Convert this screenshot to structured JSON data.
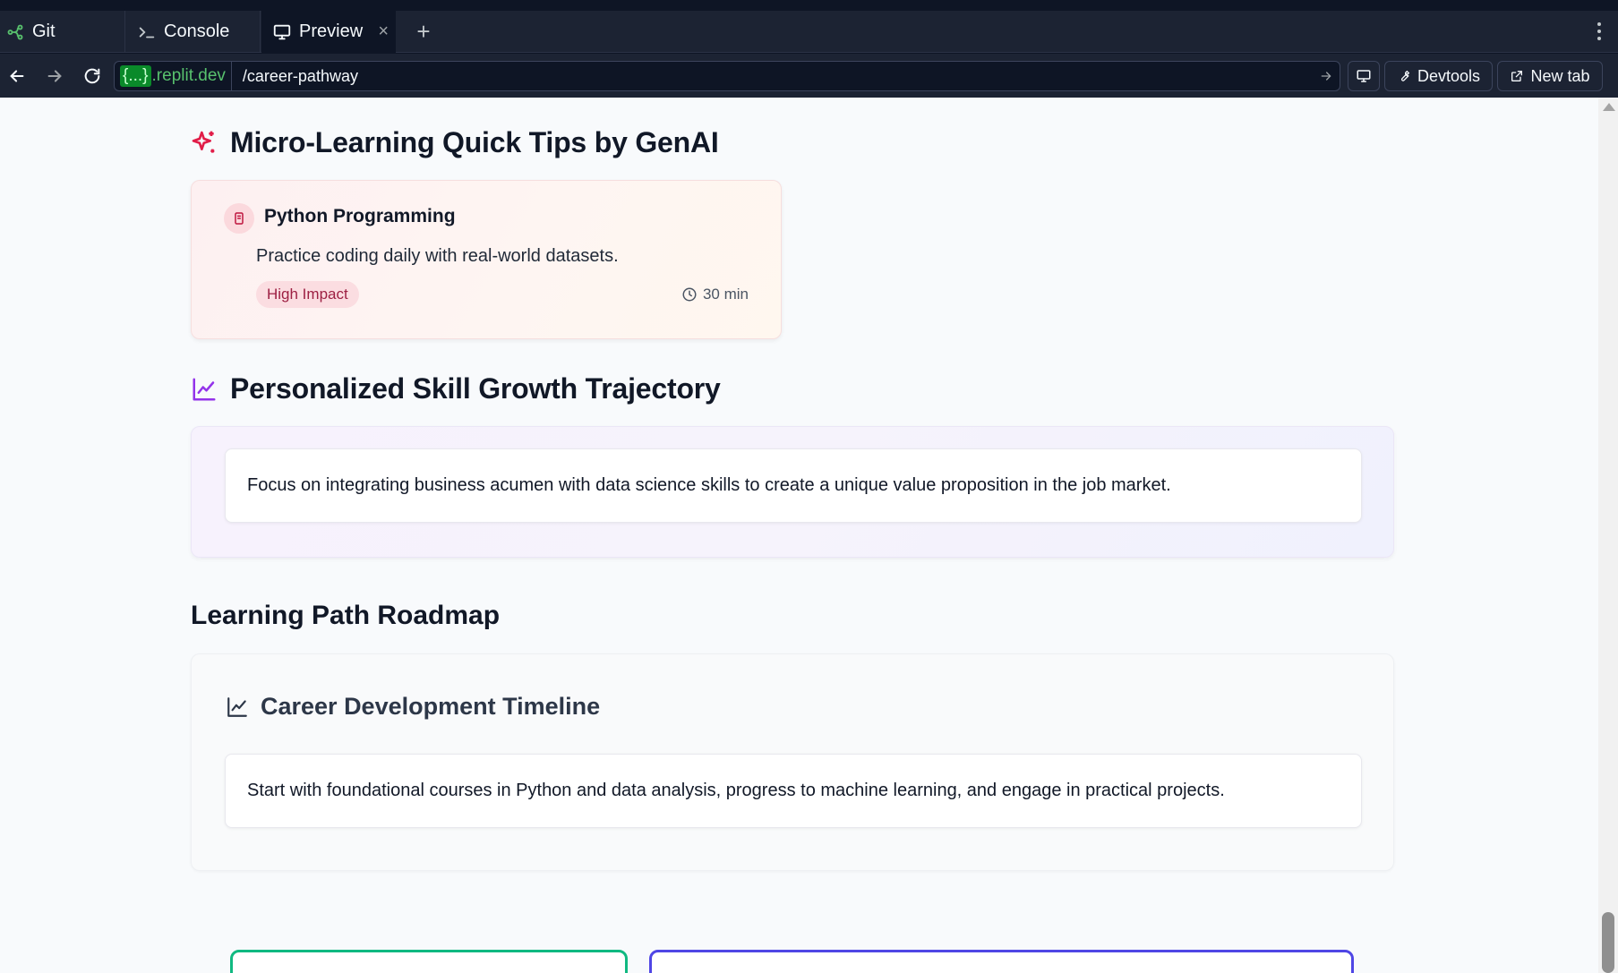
{
  "tabs": {
    "git_label": "Git",
    "console_label": "Console",
    "preview_label": "Preview"
  },
  "address": {
    "domain_brace": "{...}",
    "domain_suffix": ".replit.dev",
    "path": "/career-pathway"
  },
  "toolbar": {
    "devtools_label": "Devtools",
    "newtab_label": "New tab"
  },
  "micro_learning": {
    "heading": "Micro-Learning Quick Tips by GenAI",
    "tip": {
      "title": "Python Programming",
      "text": "Practice coding daily with real-world datasets.",
      "badge": "High Impact",
      "duration": "30 min"
    }
  },
  "skill_growth": {
    "heading": "Personalized Skill Growth Trajectory",
    "text": "Focus on integrating business acumen with data science skills to create a unique value proposition in the job market."
  },
  "roadmap": {
    "heading": "Learning Path Roadmap",
    "timeline_title": "Career Development Timeline",
    "text": "Start with foundational courses in Python and data analysis, progress to machine learning, and engage in practical projects."
  },
  "colors": {
    "accent_pink": "#e11d48",
    "accent_purple": "#9333ea",
    "card_green_border": "#10b981",
    "card_blue_border": "#4f46e5",
    "domain_green": "#58c16d"
  },
  "icons": {
    "git": "git-branch-icon",
    "console": "terminal-icon",
    "preview": "monitor-icon",
    "sparkles": "sparkles-icon",
    "chart": "line-chart-icon",
    "book": "book-icon",
    "clock": "clock-icon"
  }
}
